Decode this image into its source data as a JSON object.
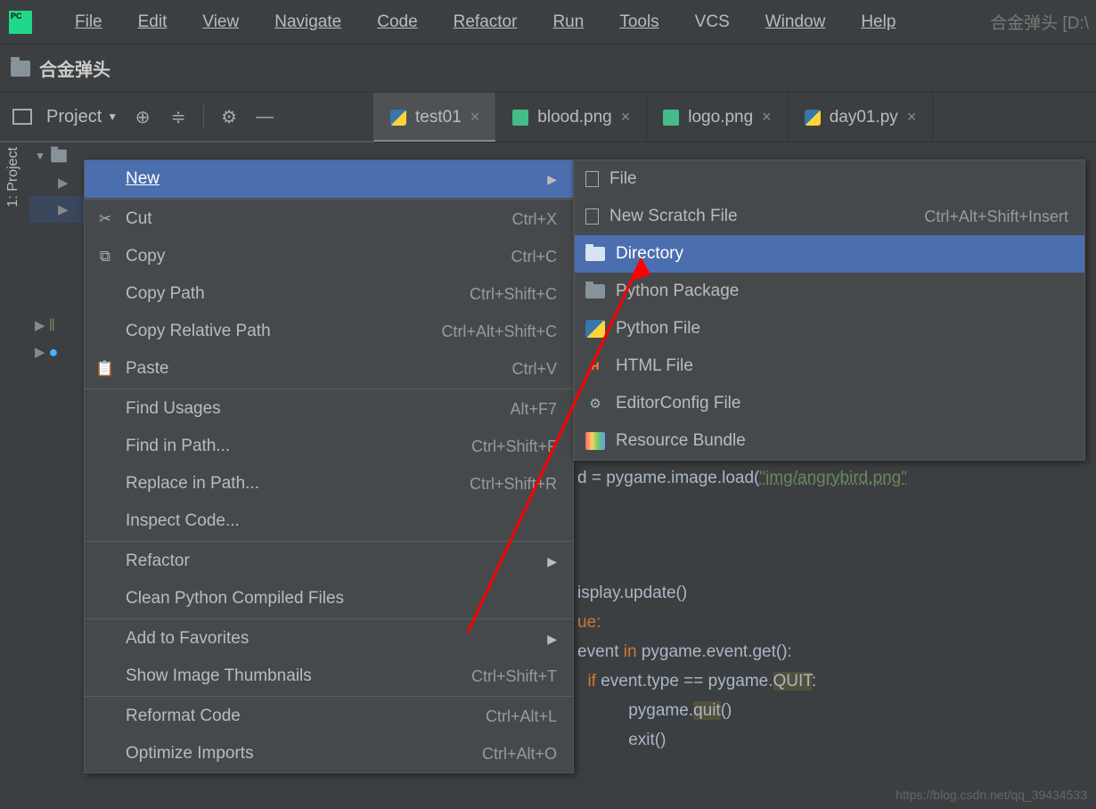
{
  "menubar": {
    "file": "File",
    "edit": "Edit",
    "view": "View",
    "navigate": "Navigate",
    "code": "Code",
    "refactor": "Refactor",
    "run": "Run",
    "tools": "Tools",
    "vcs": "VCS",
    "window": "Window",
    "help": "Help"
  },
  "title_suffix": "合金弹头 [D:\\",
  "breadcrumb": "合金弹头",
  "project_panel": {
    "label": "Project"
  },
  "sidebar_label": "1: Project",
  "tabs": [
    {
      "label": "test01",
      "type": "py",
      "active": true
    },
    {
      "label": "blood.png",
      "type": "img",
      "active": false
    },
    {
      "label": "logo.png",
      "type": "img",
      "active": false
    },
    {
      "label": "day01.py",
      "type": "py",
      "active": false
    }
  ],
  "context_menu": [
    {
      "label": "New",
      "icon": "",
      "shortcut": "",
      "sub": true,
      "hover": true
    },
    {
      "sep": true
    },
    {
      "label": "Cut",
      "icon": "✂",
      "shortcut": "Ctrl+X"
    },
    {
      "label": "Copy",
      "icon": "⧉",
      "shortcut": "Ctrl+C"
    },
    {
      "label": "Copy Path",
      "icon": "",
      "shortcut": "Ctrl+Shift+C"
    },
    {
      "label": "Copy Relative Path",
      "icon": "",
      "shortcut": "Ctrl+Alt+Shift+C"
    },
    {
      "label": "Paste",
      "icon": "📋",
      "shortcut": "Ctrl+V"
    },
    {
      "sep": true
    },
    {
      "label": "Find Usages",
      "icon": "",
      "shortcut": "Alt+F7"
    },
    {
      "label": "Find in Path...",
      "icon": "",
      "shortcut": "Ctrl+Shift+F"
    },
    {
      "label": "Replace in Path...",
      "icon": "",
      "shortcut": "Ctrl+Shift+R"
    },
    {
      "label": "Inspect Code...",
      "icon": "",
      "shortcut": ""
    },
    {
      "sep": true
    },
    {
      "label": "Refactor",
      "icon": "",
      "shortcut": "",
      "sub": true
    },
    {
      "label": "Clean Python Compiled Files",
      "icon": "",
      "shortcut": ""
    },
    {
      "sep": true
    },
    {
      "label": "Add to Favorites",
      "icon": "",
      "shortcut": "",
      "sub": true
    },
    {
      "label": "Show Image Thumbnails",
      "icon": "",
      "shortcut": "Ctrl+Shift+T"
    },
    {
      "sep": true
    },
    {
      "label": "Reformat Code",
      "icon": "",
      "shortcut": "Ctrl+Alt+L"
    },
    {
      "label": "Optimize Imports",
      "icon": "",
      "shortcut": "Ctrl+Alt+O"
    }
  ],
  "submenu_new": [
    {
      "label": "File",
      "icon": "file"
    },
    {
      "label": "New Scratch File",
      "icon": "file",
      "shortcut": "Ctrl+Alt+Shift+Insert"
    },
    {
      "label": "Directory",
      "icon": "folder",
      "hover": true
    },
    {
      "label": "Python Package",
      "icon": "folder"
    },
    {
      "label": "Python File",
      "icon": "py"
    },
    {
      "label": "HTML File",
      "icon": "html"
    },
    {
      "label": "EditorConfig File",
      "icon": "gear"
    },
    {
      "label": "Resource Bundle",
      "icon": "bundle"
    }
  ],
  "code": {
    "line1_prefix": "d = pygame.image.load(",
    "line1_str": "\"img/angrybird.png\"",
    "line2": "isplay.update()",
    "line3": "ue:",
    "line4a": "event ",
    "line4b": "in ",
    "line4c": "pygame.event.get():",
    "line5a": "if ",
    "line5b": "event.type == pygame.",
    "line5c": "QUIT",
    "line5d": ":",
    "line6a": "pygame.",
    "line6b": "quit",
    "line6c": "()",
    "line7": "exit()"
  },
  "watermark": "https://blog.csdn.net/qq_39434533"
}
